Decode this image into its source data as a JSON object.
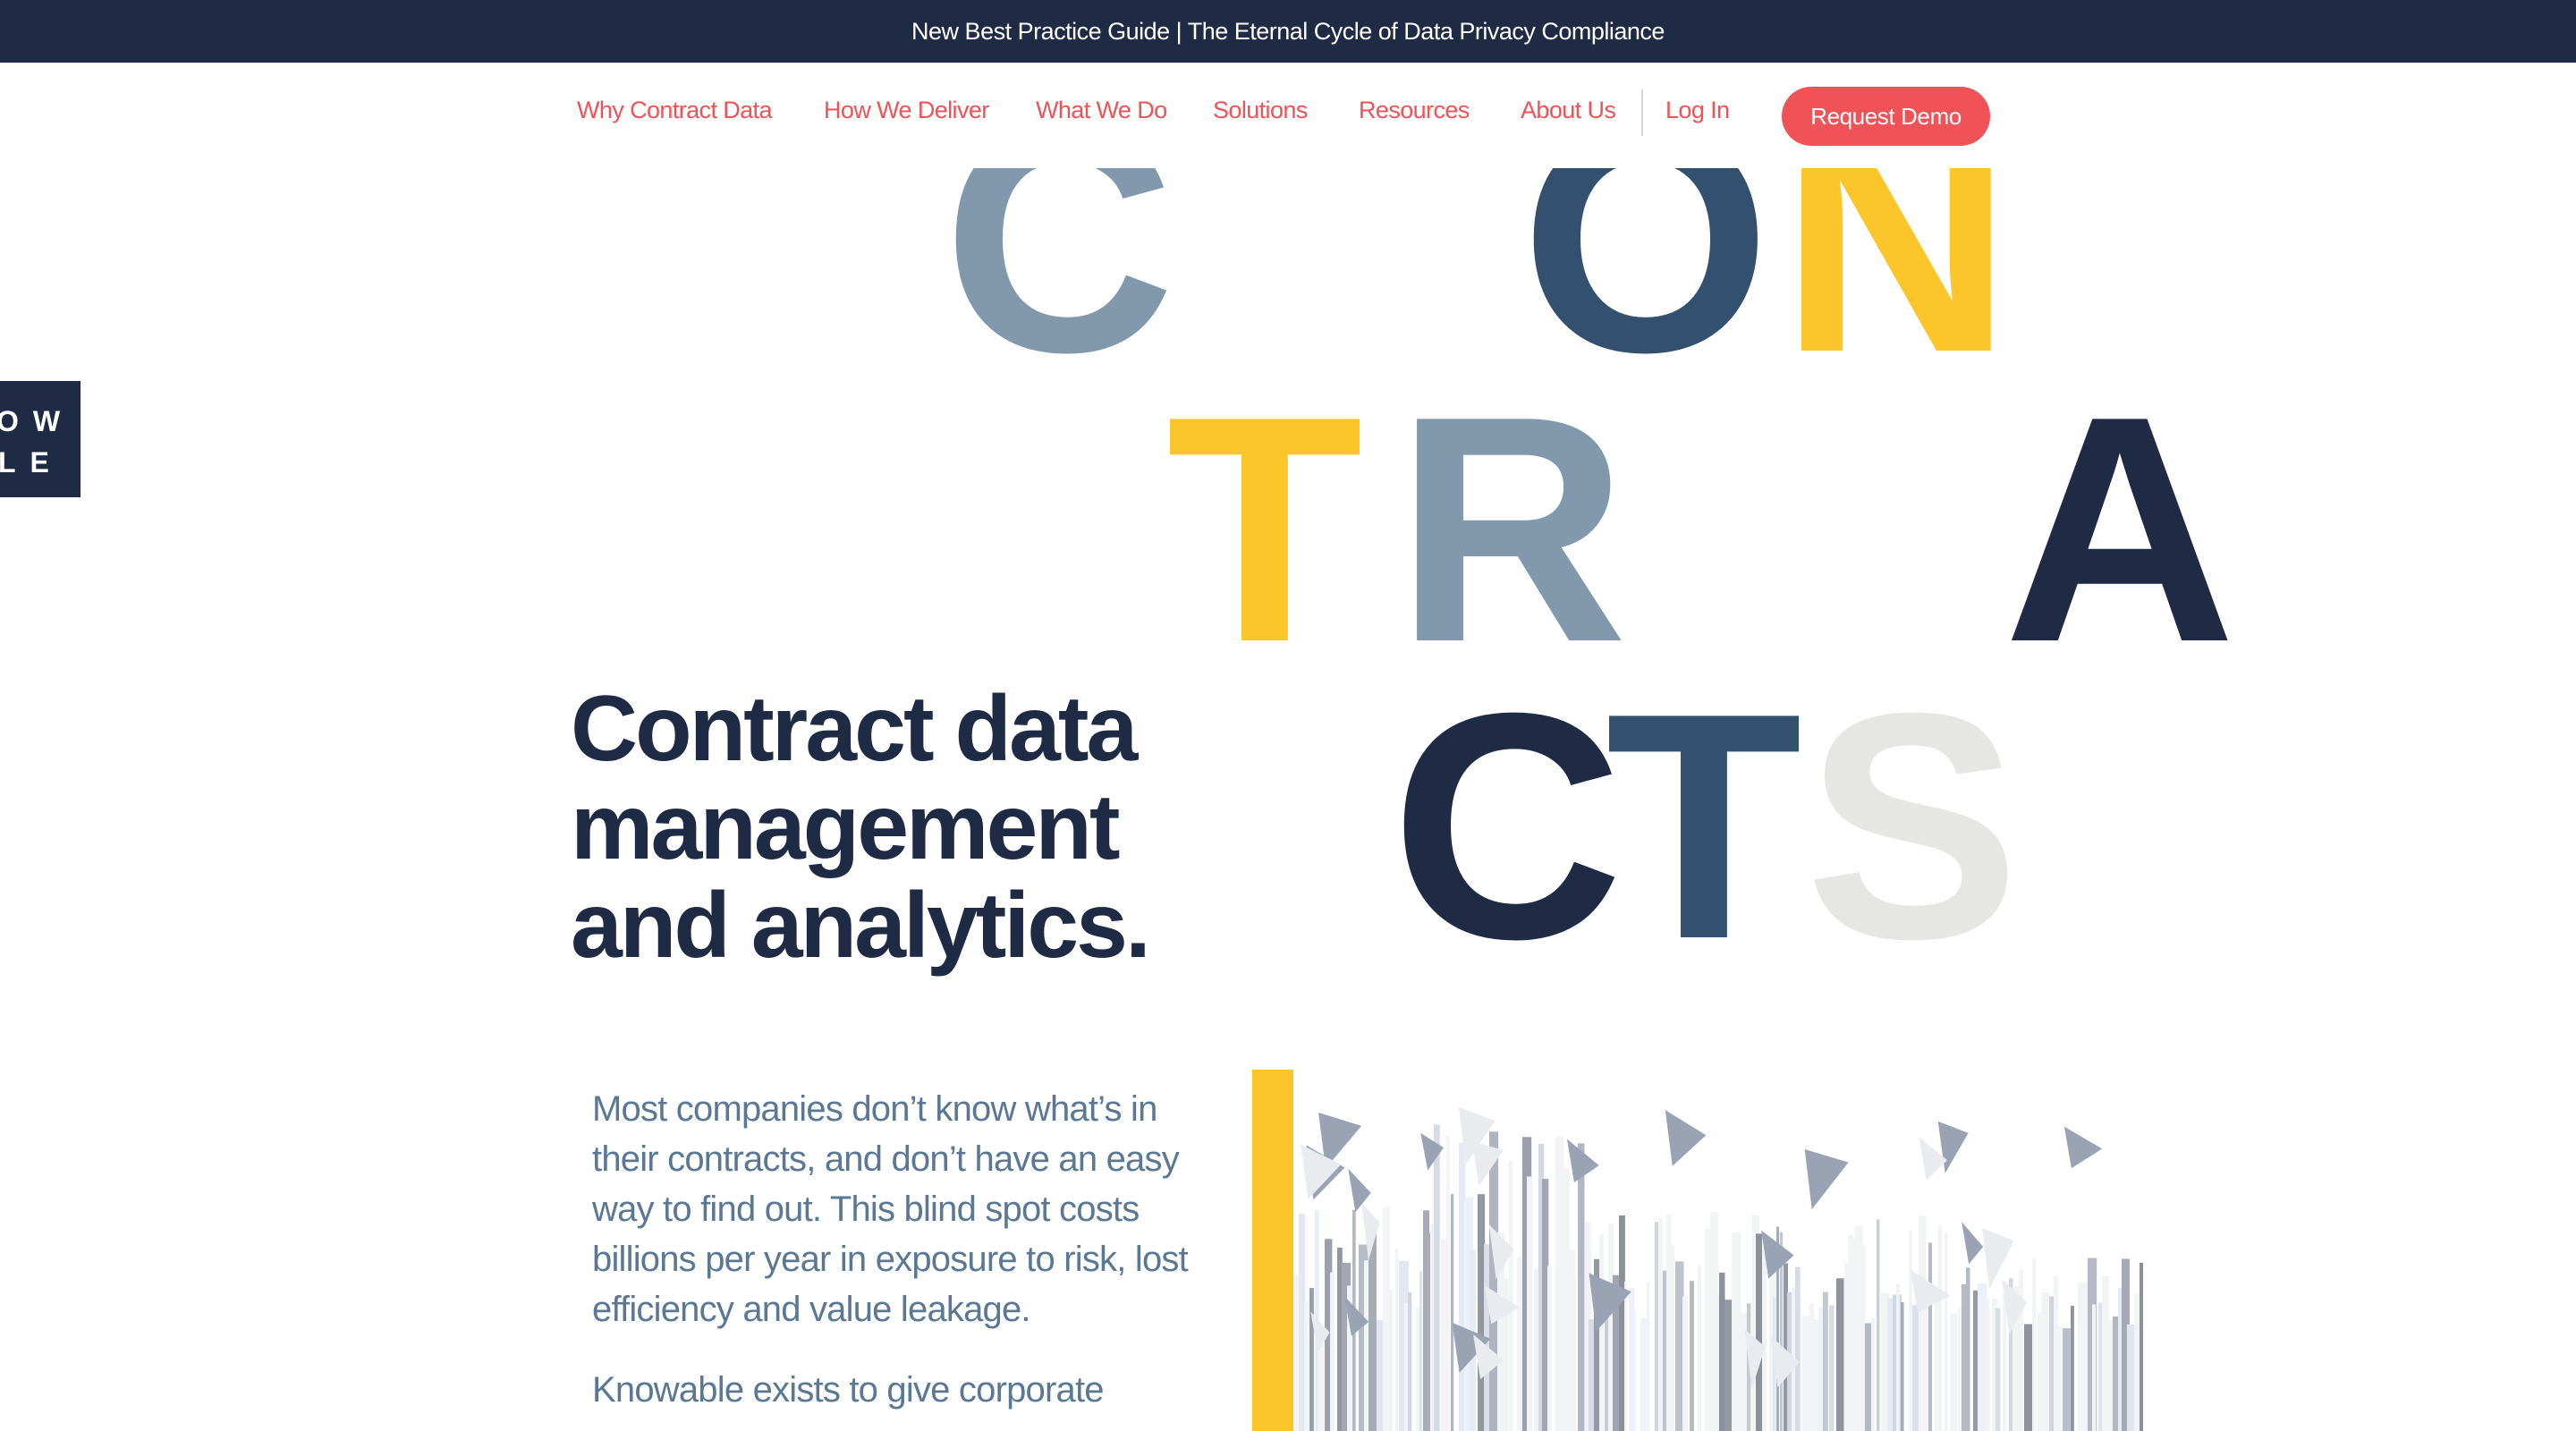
{
  "banner": {
    "text": "New Best Practice Guide | The Eternal Cycle of Data Privacy Compliance"
  },
  "nav": {
    "items": [
      {
        "label": "Why Contract Data"
      },
      {
        "label": "How We Deliver"
      },
      {
        "label": "What We Do"
      },
      {
        "label": "Solutions"
      },
      {
        "label": "Resources"
      },
      {
        "label": "About Us"
      }
    ],
    "login": "Log In",
    "cta": "Request Demo"
  },
  "logo": {
    "lines": [
      "OW",
      "LE"
    ]
  },
  "hero_letters": {
    "letters": [
      {
        "char": "C",
        "color": "#8198ad"
      },
      {
        "char": "O",
        "color": "#33506e"
      },
      {
        "char": "N",
        "color": "#fcc62a"
      },
      {
        "char": "T",
        "color": "#fcc62a"
      },
      {
        "char": "R",
        "color": "#8198ad"
      },
      {
        "char": "A",
        "color": "#1f2a44"
      },
      {
        "char": "C",
        "color": "#1f2a44"
      },
      {
        "char": "T",
        "color": "#33506e"
      },
      {
        "char": "S",
        "color": "#e6e7e4"
      }
    ]
  },
  "hero": {
    "headline_lines": [
      "Contract data",
      "management",
      "and analytics."
    ],
    "paragraphs": [
      "Most companies don’t know what’s in their contracts, and don’t have an easy way to find out. This blind spot costs billions per year in exposure to risk, lost efficiency and value leakage.",
      "Knowable exists to give corporate"
    ]
  },
  "colors": {
    "navy": "#1f2a44",
    "coral": "#ef5357",
    "yellow": "#fcc62a",
    "slate": "#8198ad",
    "steel": "#33506e",
    "light_gray": "#e6e7e4",
    "body_text": "#5a7894"
  }
}
